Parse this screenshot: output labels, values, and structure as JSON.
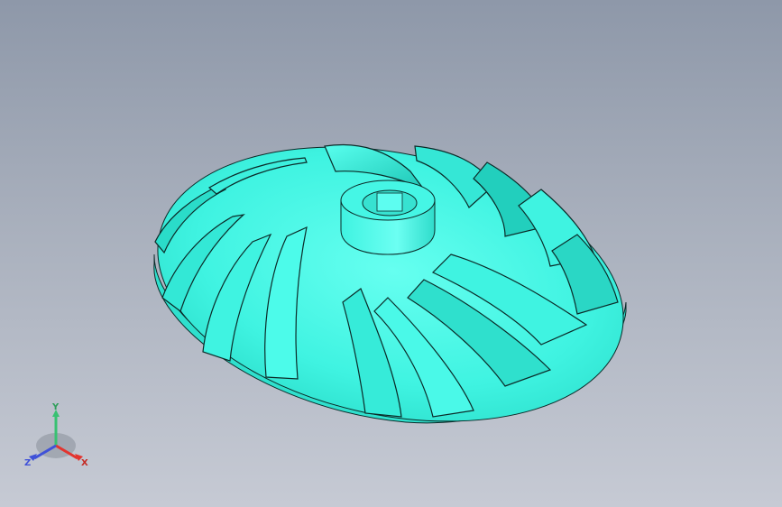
{
  "viewport": {
    "background_top": "#8e98a9",
    "background_bottom": "#c6cad4"
  },
  "model": {
    "part": "impeller",
    "face_color": "#3ff3e1",
    "shade_color": "#1fc9b8",
    "rim_color": "#2ee0cd",
    "edge_color": "#0b2a28"
  },
  "triad": {
    "x_label": "X",
    "y_label": "Y",
    "z_label": "Z",
    "x_color": "#e3342f",
    "y_color": "#38c172",
    "z_color": "#3f51d8"
  }
}
